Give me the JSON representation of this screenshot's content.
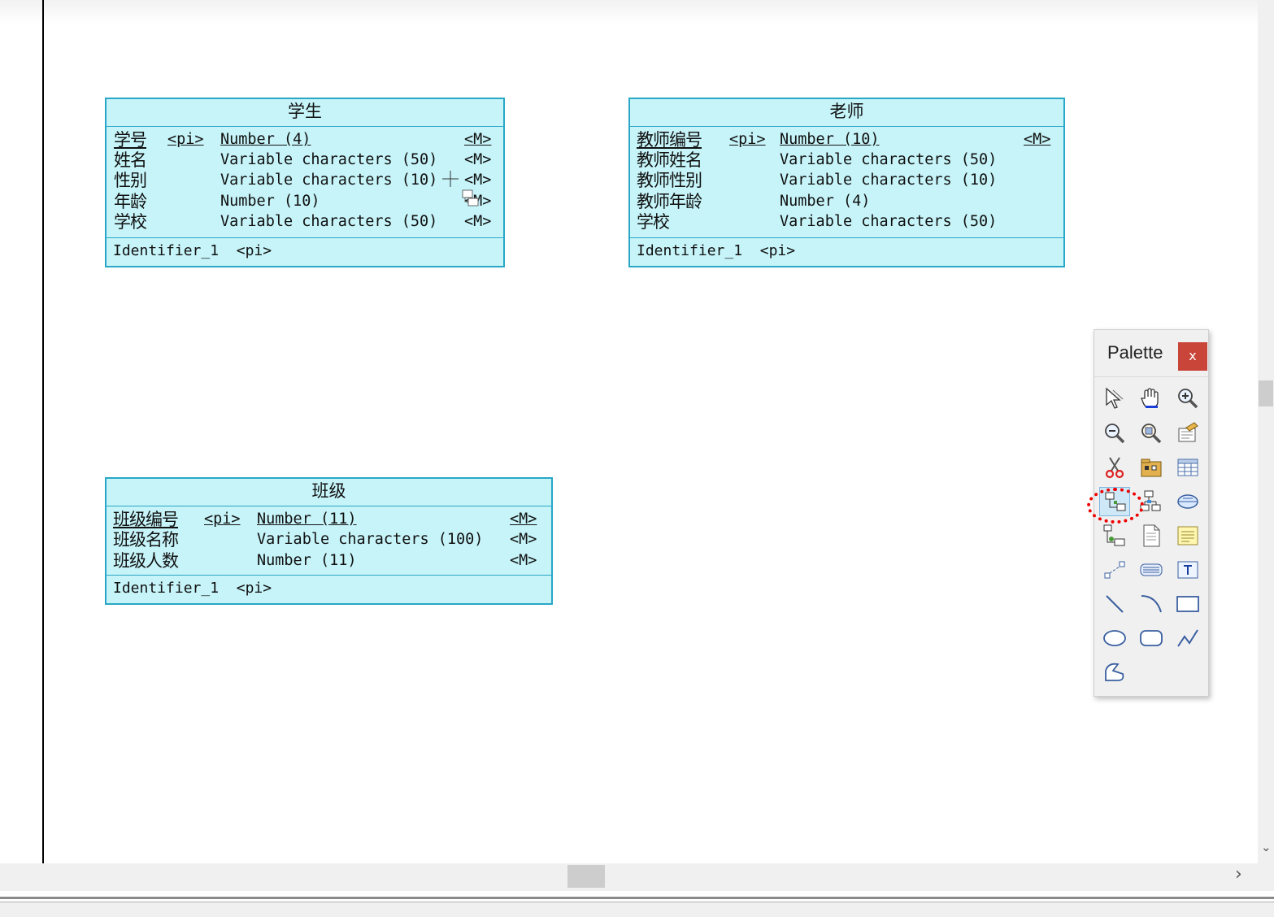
{
  "entities": [
    {
      "title": "学生",
      "attributes": [
        {
          "name": "学号",
          "pi": "<pi>",
          "type": "Number (4)",
          "mandatory": "<M>"
        },
        {
          "name": "姓名",
          "pi": "",
          "type": "Variable characters (50)",
          "mandatory": "<M>"
        },
        {
          "name": "性别",
          "pi": "",
          "type": "Variable characters (10)",
          "mandatory": "<M>"
        },
        {
          "name": "年龄",
          "pi": "",
          "type": "Number (10)",
          "mandatory": "<M>"
        },
        {
          "name": "学校",
          "pi": "",
          "type": "Variable characters (50)",
          "mandatory": "<M>"
        }
      ],
      "identifier": "Identifier_1",
      "identifier_tag": "<pi>"
    },
    {
      "title": "老师",
      "attributes": [
        {
          "name": "教师编号",
          "pi": "<pi>",
          "type": "Number (10)",
          "mandatory": "<M>"
        },
        {
          "name": "教师姓名",
          "pi": "",
          "type": "Variable characters (50)",
          "mandatory": ""
        },
        {
          "name": "教师性别",
          "pi": "",
          "type": "Variable characters (10)",
          "mandatory": ""
        },
        {
          "name": "教师年龄",
          "pi": "",
          "type": "Number (4)",
          "mandatory": ""
        },
        {
          "name": "学校",
          "pi": "",
          "type": "Variable characters (50)",
          "mandatory": ""
        }
      ],
      "identifier": "Identifier_1",
      "identifier_tag": "<pi>"
    },
    {
      "title": "班级",
      "attributes": [
        {
          "name": "班级编号",
          "pi": "<pi>",
          "type": "Number (11)",
          "mandatory": "<M>"
        },
        {
          "name": "班级名称",
          "pi": "",
          "type": "Variable characters (100)",
          "mandatory": "<M>"
        },
        {
          "name": "班级人数",
          "pi": "",
          "type": "Number (11)",
          "mandatory": "<M>"
        }
      ],
      "identifier": "Identifier_1",
      "identifier_tag": "<pi>"
    }
  ],
  "palette": {
    "title": "Palette",
    "close_label": "x",
    "selected_tool": "relationship-tool",
    "tools": [
      "pointer-tool",
      "grabber-tool",
      "zoom-in-tool",
      "zoom-out-tool",
      "open-package-tool",
      "properties-tool",
      "delete-tool",
      "package-tool",
      "entity-tool",
      "relationship-tool",
      "association-tool",
      "association-link-tool",
      "inheritance-tool",
      "file-tool",
      "note-tool",
      "link-tool",
      "title-tool",
      "text-tool",
      "line-tool",
      "arc-tool",
      "rectangle-tool",
      "ellipse-tool",
      "rounded-rectangle-tool",
      "polyline-tool",
      "polygon-tool"
    ]
  },
  "colors": {
    "entity_fill": "#c6f4f9",
    "entity_border": "#2aa7c6",
    "highlight": "#e00000"
  }
}
